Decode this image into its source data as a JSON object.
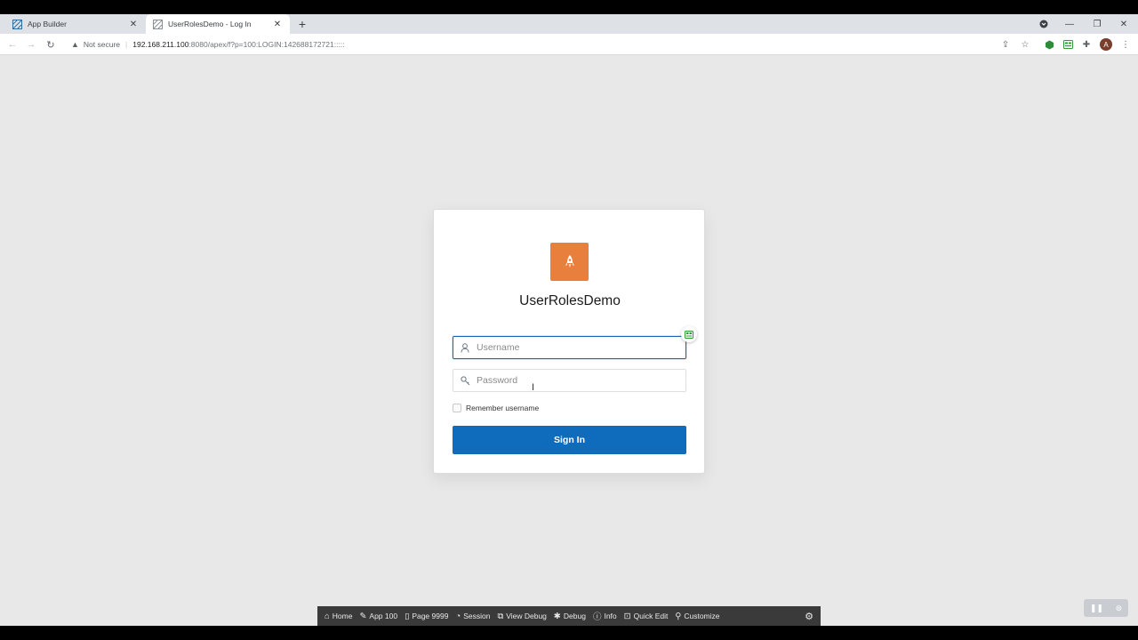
{
  "browser": {
    "tabs": [
      {
        "title": "App Builder",
        "active": false
      },
      {
        "title": "UserRolesDemo - Log In",
        "active": true
      }
    ],
    "security_label": "Not secure",
    "url_host": "192.168.211.100",
    "url_path": ":8080/apex/f?p=100:LOGIN:142688172721:::::",
    "avatar_letter": "A"
  },
  "login": {
    "app_name": "UserRolesDemo",
    "username_placeholder": "Username",
    "password_placeholder": "Password",
    "remember_label": "Remember username",
    "sign_in_label": "Sign In",
    "accent_color": "#0f6cbd",
    "logo_color": "#e97f3c"
  },
  "dev_toolbar": {
    "items": [
      {
        "label": "Home",
        "icon": "home-icon"
      },
      {
        "label": "App 100",
        "icon": "edit-icon"
      },
      {
        "label": "Page 9999",
        "icon": "page-edit-icon"
      },
      {
        "label": "Session",
        "icon": "session-icon"
      },
      {
        "label": "View Debug",
        "icon": "view-debug-icon"
      },
      {
        "label": "Debug",
        "icon": "bug-icon"
      },
      {
        "label": "Info",
        "icon": "info-icon"
      },
      {
        "label": "Quick Edit",
        "icon": "quick-edit-icon"
      },
      {
        "label": "Customize",
        "icon": "customize-icon"
      }
    ]
  }
}
